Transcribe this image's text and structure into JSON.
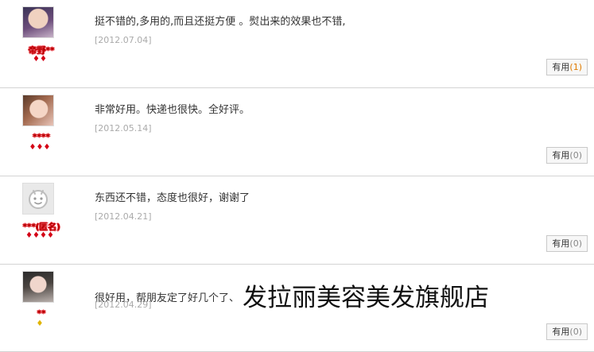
{
  "reviews": [
    {
      "username": "帝野**",
      "gems": "♦♦",
      "comment": "挺不错的,多用的,而且还挺方便 。熨出来的效果也不错,",
      "date": "[2012.07.04]",
      "useful_label": "有用",
      "useful_count": "(1)"
    },
    {
      "username": "****",
      "gems": "♦♦♦",
      "comment": "非常好用。快递也很快。全好评。",
      "date": "[2012.05.14]",
      "useful_label": "有用",
      "useful_count": "(0)"
    },
    {
      "username": "***(匿名)",
      "gems": "♦♦♦♦",
      "comment": "东西还不错，态度也很好，谢谢了",
      "date": "[2012.04.21]",
      "useful_label": "有用",
      "useful_count": "(0)"
    },
    {
      "username": "**",
      "gems": "♦",
      "comment": "很好用，帮朋友定了好几个了、",
      "comment_overlay": "发拉丽美容美发旗舰店",
      "date": "[2012.04.29]",
      "useful_label": "有用",
      "useful_count": "(0)"
    }
  ],
  "colors": {
    "username_red": "#a30000",
    "gem_red": "#d40016",
    "gem_gold": "#e0b400",
    "date_gray": "#aaaaaa",
    "count_orange": "#e07b00",
    "divider": "#d4d4d4"
  }
}
